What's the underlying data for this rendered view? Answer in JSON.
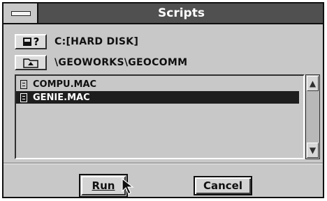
{
  "window": {
    "title": "Scripts"
  },
  "drive": {
    "button_icon": "drive-query-icon",
    "button_label": "?",
    "path": "C:[HARD DISK]"
  },
  "folder": {
    "button_icon": "folder-up-icon",
    "path": "\\GEOWORKS\\GEOCOMM"
  },
  "files": [
    {
      "name": "COMPU.MAC",
      "selected": false
    },
    {
      "name": "GENIE.MAC",
      "selected": true
    }
  ],
  "buttons": {
    "run": "Run",
    "cancel": "Cancel"
  },
  "colors": {
    "title_bar": "#505050",
    "face": "#c8c8c8",
    "selection": "#1e1e1e"
  }
}
